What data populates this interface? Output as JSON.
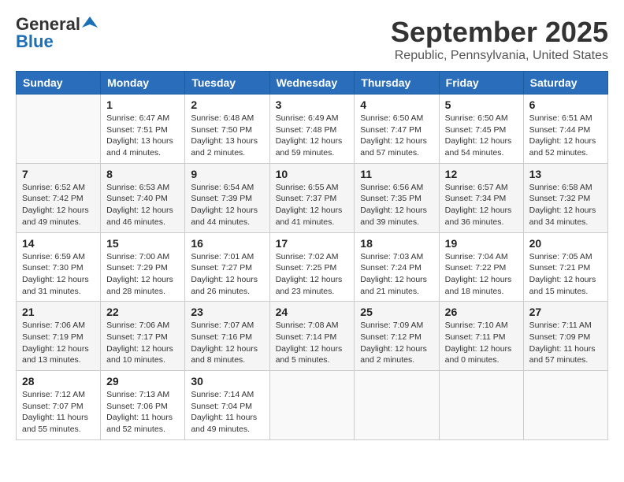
{
  "header": {
    "logo_general": "General",
    "logo_blue": "Blue",
    "month": "September 2025",
    "location": "Republic, Pennsylvania, United States"
  },
  "weekdays": [
    "Sunday",
    "Monday",
    "Tuesday",
    "Wednesday",
    "Thursday",
    "Friday",
    "Saturday"
  ],
  "weeks": [
    [
      {
        "day": "",
        "info": ""
      },
      {
        "day": "1",
        "info": "Sunrise: 6:47 AM\nSunset: 7:51 PM\nDaylight: 13 hours\nand 4 minutes."
      },
      {
        "day": "2",
        "info": "Sunrise: 6:48 AM\nSunset: 7:50 PM\nDaylight: 13 hours\nand 2 minutes."
      },
      {
        "day": "3",
        "info": "Sunrise: 6:49 AM\nSunset: 7:48 PM\nDaylight: 12 hours\nand 59 minutes."
      },
      {
        "day": "4",
        "info": "Sunrise: 6:50 AM\nSunset: 7:47 PM\nDaylight: 12 hours\nand 57 minutes."
      },
      {
        "day": "5",
        "info": "Sunrise: 6:50 AM\nSunset: 7:45 PM\nDaylight: 12 hours\nand 54 minutes."
      },
      {
        "day": "6",
        "info": "Sunrise: 6:51 AM\nSunset: 7:44 PM\nDaylight: 12 hours\nand 52 minutes."
      }
    ],
    [
      {
        "day": "7",
        "info": "Sunrise: 6:52 AM\nSunset: 7:42 PM\nDaylight: 12 hours\nand 49 minutes."
      },
      {
        "day": "8",
        "info": "Sunrise: 6:53 AM\nSunset: 7:40 PM\nDaylight: 12 hours\nand 46 minutes."
      },
      {
        "day": "9",
        "info": "Sunrise: 6:54 AM\nSunset: 7:39 PM\nDaylight: 12 hours\nand 44 minutes."
      },
      {
        "day": "10",
        "info": "Sunrise: 6:55 AM\nSunset: 7:37 PM\nDaylight: 12 hours\nand 41 minutes."
      },
      {
        "day": "11",
        "info": "Sunrise: 6:56 AM\nSunset: 7:35 PM\nDaylight: 12 hours\nand 39 minutes."
      },
      {
        "day": "12",
        "info": "Sunrise: 6:57 AM\nSunset: 7:34 PM\nDaylight: 12 hours\nand 36 minutes."
      },
      {
        "day": "13",
        "info": "Sunrise: 6:58 AM\nSunset: 7:32 PM\nDaylight: 12 hours\nand 34 minutes."
      }
    ],
    [
      {
        "day": "14",
        "info": "Sunrise: 6:59 AM\nSunset: 7:30 PM\nDaylight: 12 hours\nand 31 minutes."
      },
      {
        "day": "15",
        "info": "Sunrise: 7:00 AM\nSunset: 7:29 PM\nDaylight: 12 hours\nand 28 minutes."
      },
      {
        "day": "16",
        "info": "Sunrise: 7:01 AM\nSunset: 7:27 PM\nDaylight: 12 hours\nand 26 minutes."
      },
      {
        "day": "17",
        "info": "Sunrise: 7:02 AM\nSunset: 7:25 PM\nDaylight: 12 hours\nand 23 minutes."
      },
      {
        "day": "18",
        "info": "Sunrise: 7:03 AM\nSunset: 7:24 PM\nDaylight: 12 hours\nand 21 minutes."
      },
      {
        "day": "19",
        "info": "Sunrise: 7:04 AM\nSunset: 7:22 PM\nDaylight: 12 hours\nand 18 minutes."
      },
      {
        "day": "20",
        "info": "Sunrise: 7:05 AM\nSunset: 7:21 PM\nDaylight: 12 hours\nand 15 minutes."
      }
    ],
    [
      {
        "day": "21",
        "info": "Sunrise: 7:06 AM\nSunset: 7:19 PM\nDaylight: 12 hours\nand 13 minutes."
      },
      {
        "day": "22",
        "info": "Sunrise: 7:06 AM\nSunset: 7:17 PM\nDaylight: 12 hours\nand 10 minutes."
      },
      {
        "day": "23",
        "info": "Sunrise: 7:07 AM\nSunset: 7:16 PM\nDaylight: 12 hours\nand 8 minutes."
      },
      {
        "day": "24",
        "info": "Sunrise: 7:08 AM\nSunset: 7:14 PM\nDaylight: 12 hours\nand 5 minutes."
      },
      {
        "day": "25",
        "info": "Sunrise: 7:09 AM\nSunset: 7:12 PM\nDaylight: 12 hours\nand 2 minutes."
      },
      {
        "day": "26",
        "info": "Sunrise: 7:10 AM\nSunset: 7:11 PM\nDaylight: 12 hours\nand 0 minutes."
      },
      {
        "day": "27",
        "info": "Sunrise: 7:11 AM\nSunset: 7:09 PM\nDaylight: 11 hours\nand 57 minutes."
      }
    ],
    [
      {
        "day": "28",
        "info": "Sunrise: 7:12 AM\nSunset: 7:07 PM\nDaylight: 11 hours\nand 55 minutes."
      },
      {
        "day": "29",
        "info": "Sunrise: 7:13 AM\nSunset: 7:06 PM\nDaylight: 11 hours\nand 52 minutes."
      },
      {
        "day": "30",
        "info": "Sunrise: 7:14 AM\nSunset: 7:04 PM\nDaylight: 11 hours\nand 49 minutes."
      },
      {
        "day": "",
        "info": ""
      },
      {
        "day": "",
        "info": ""
      },
      {
        "day": "",
        "info": ""
      },
      {
        "day": "",
        "info": ""
      }
    ]
  ]
}
